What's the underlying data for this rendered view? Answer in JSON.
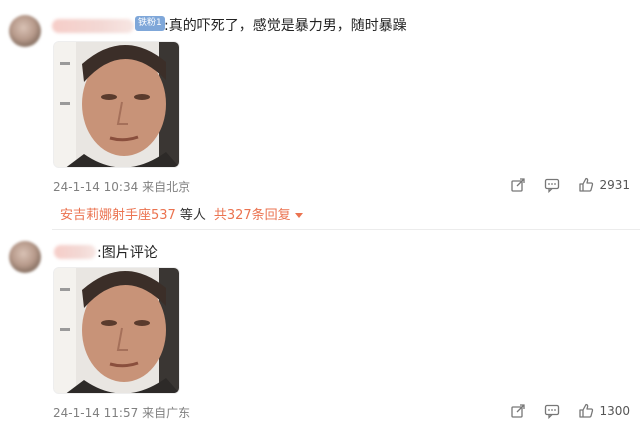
{
  "comments": [
    {
      "badge": "铁粉1",
      "text": ":真的吓死了，感觉是暴力男，随时暴躁",
      "date": "24-1-14 10:34",
      "location": "来自北京",
      "likes": "2931",
      "replies": {
        "user": "安吉莉娜射手座537",
        "suffix": "等人",
        "total": "共327条回复"
      }
    },
    {
      "text": ":图片评论",
      "date": "24-1-14 11:57",
      "location": "来自广东",
      "likes": "1300"
    }
  ],
  "icons": [
    "share-icon",
    "comment-icon",
    "like-icon",
    "reply-expand-icon"
  ],
  "colors": {
    "accent": "#eb7350",
    "meta": "#808080",
    "badge": "#7fa7d9"
  }
}
